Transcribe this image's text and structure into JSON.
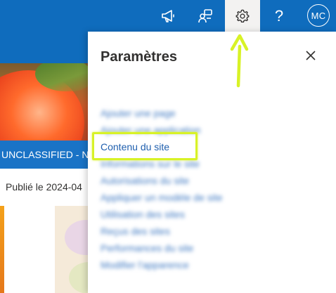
{
  "topbar": {
    "icons": [
      "megaphone-icon",
      "people-settings-icon",
      "gear-icon",
      "help-icon"
    ],
    "help_label": "?",
    "avatar_initials": "MC",
    "background_color": "#0f6cbd"
  },
  "background_page": {
    "classification_banner": "UNCLASSIFIED - NC",
    "published_text": "Publié le 2024-04"
  },
  "settings_panel": {
    "title": "Paramètres",
    "close_icon": "close-icon",
    "menu_items": [
      "Ajouter une page",
      "Ajouter une application",
      "Contenu du site",
      "Informations sur le site",
      "Autorisations du site",
      "Appliquer un modèle de site",
      "Utilisation des sites",
      "Reçus des sites",
      "Performances du site",
      "Modifier l'apparence"
    ]
  },
  "annotation": {
    "highlight_color": "#d8f226"
  }
}
